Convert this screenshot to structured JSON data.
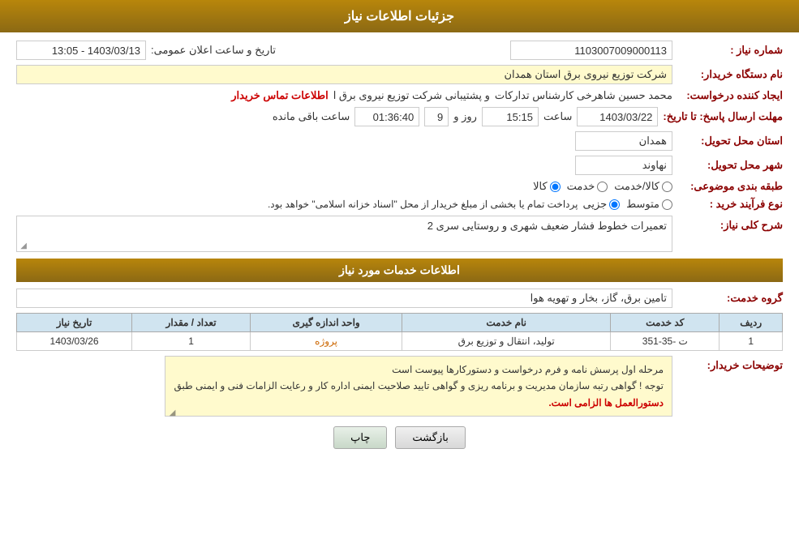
{
  "header": {
    "title": "جزئیات اطلاعات نیاز"
  },
  "fields": {
    "need_number_label": "شماره نیاز :",
    "need_number_value": "1103007009000113",
    "buyer_org_label": "نام دستگاه خریدار:",
    "buyer_org_value": "شرکت توزیع نیروی برق استان همدان",
    "requester_label": "ایجاد کننده درخواست:",
    "requester_value": "محمد حسین شاهرخی کارشناس تدارکات",
    "requester_suffix": "و پشتیبانی شرکت توزیع نیروی برق ا",
    "contact_link": "اطلاعات تماس خریدار",
    "deadline_label": "مهلت ارسال پاسخ: تا تاریخ:",
    "deadline_date": "1403/03/22",
    "deadline_time_label": "ساعت",
    "deadline_time": "15:15",
    "deadline_days_label": "روز و",
    "deadline_days": "9",
    "deadline_remaining": "01:36:40",
    "deadline_remaining_label": "ساعت باقی مانده",
    "announce_label": "تاریخ و ساعت اعلان عمومی:",
    "announce_value": "1403/03/13 - 13:05",
    "province_label": "استان محل تحویل:",
    "province_value": "همدان",
    "city_label": "شهر محل تحویل:",
    "city_value": "نهاوند",
    "category_label": "طبقه بندی موضوعی:",
    "category_options": [
      "کالا",
      "خدمت",
      "کالا/خدمت"
    ],
    "category_selected": "کالا",
    "purchase_type_label": "نوع فرآیند خرید :",
    "purchase_options": [
      "جزیی",
      "متوسط"
    ],
    "purchase_suffix": "پرداخت تمام یا بخشی از مبلغ خریدار از محل \"اسناد خزانه اسلامی\" خواهد بود.",
    "need_desc_label": "شرح کلی نیاز:",
    "need_desc_value": "تعمیرات خطوط فشار ضعیف شهری و روستایی سری 2",
    "services_section": "اطلاعات خدمات مورد نیاز",
    "service_group_label": "گروه خدمت:",
    "service_group_value": "تامین برق، گاز، بخار و تهویه هوا"
  },
  "table": {
    "headers": [
      "ردیف",
      "کد خدمت",
      "نام خدمت",
      "واحد اندازه گیری",
      "تعداد / مقدار",
      "تاریخ نیاز"
    ],
    "rows": [
      {
        "row": "1",
        "code": "ت -35-351",
        "name": "تولید، انتقال و توزیع برق",
        "unit": "پروژه",
        "qty": "1",
        "date": "1403/03/26"
      }
    ]
  },
  "notes": {
    "label": "توضیحات خریدار:",
    "line1": "مرحله اول پرسش نامه و فرم درخواست و دستورکارها پیوست است",
    "line2": "توجه ! گواهی رتبه سازمان مدیریت و برنامه ریزی و گواهی تایید صلاحیت ایمنی اداره کار و رعایت الزامات فنی و ایمنی طبق",
    "line3": "دستورالعمل ها الزامی است."
  },
  "buttons": {
    "print": "چاپ",
    "back": "بازگشت"
  }
}
